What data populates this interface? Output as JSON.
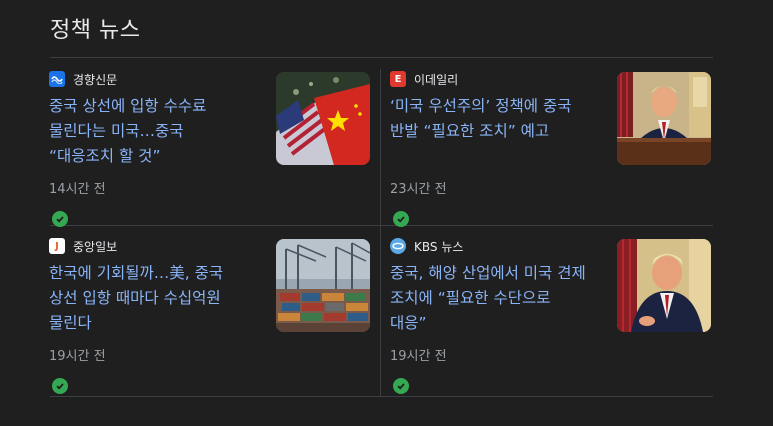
{
  "section": {
    "title": "정책 뉴스"
  },
  "articles": [
    {
      "source": "경향신문",
      "headline": "중국 상선에 입항 수수료 물린다는 미국…중국 “대응조치 할 것”",
      "time": "14시간 전",
      "logo_text": "",
      "logo_color": "#1a73e8"
    },
    {
      "source": "이데일리",
      "headline": "‘미국 우선주의’ 정책에 중국 반발 “필요한 조치” 예고",
      "time": "23시간 전",
      "logo_text": "E",
      "logo_color": "#e03a2f"
    },
    {
      "source": "중앙일보",
      "headline": "한국에 기회될까…美, 중국 상선 입항 때마다 수십억원 물린다",
      "time": "19시간 전",
      "logo_text": "J",
      "logo_color": "#e8a33d"
    },
    {
      "source": "KBS 뉴스",
      "headline": "중국, 해양 산업에서 미국 견제 조치에 “필요한 수단으로 대응”",
      "time": "19시간 전",
      "logo_text": "",
      "logo_color": "#5aa9e6"
    }
  ],
  "colors": {
    "background": "#1f1f1f",
    "link": "#8ab4f8",
    "muted": "#9aa0a6",
    "check": "#34a853"
  }
}
